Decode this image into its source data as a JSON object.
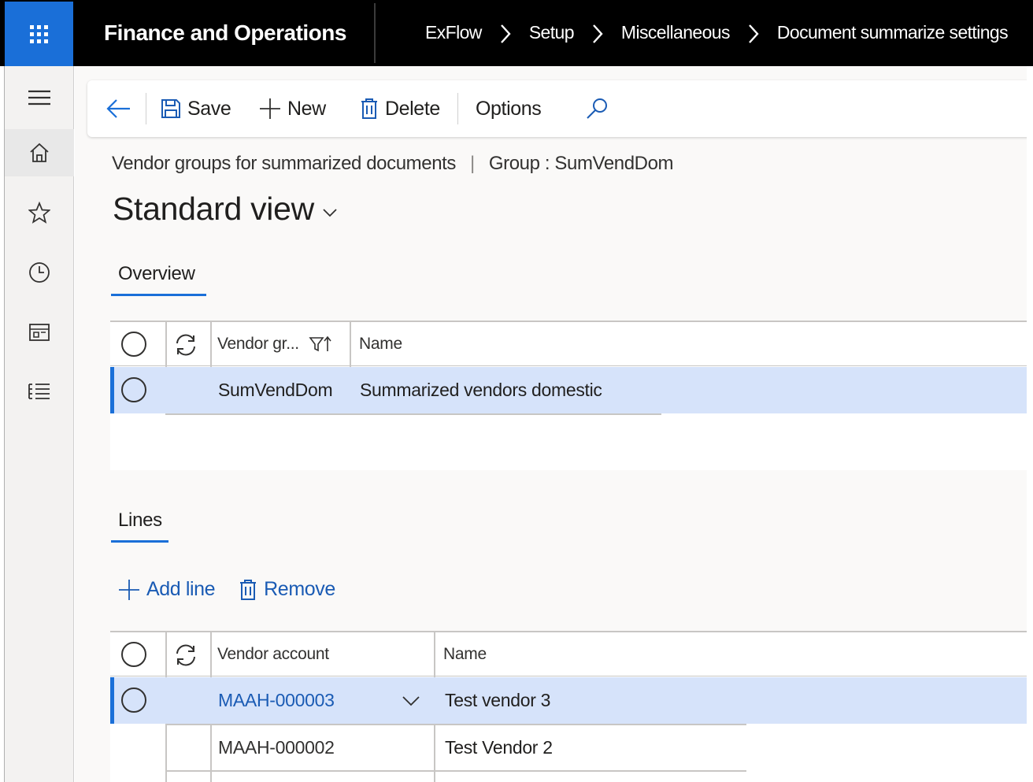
{
  "app": {
    "title": "Finance and Operations",
    "breadcrumb": [
      "ExFlow",
      "Setup",
      "Miscellaneous",
      "Document summarize settings"
    ]
  },
  "nav": {
    "items": [
      "home-icon",
      "favorites-star-icon",
      "recent-clock-icon",
      "workspaces-icon",
      "modules-list-icon"
    ]
  },
  "toolbar": {
    "save_label": "Save",
    "new_label": "New",
    "delete_label": "Delete",
    "options_label": "Options"
  },
  "page": {
    "caption": "Vendor groups for summarized documents",
    "caption_separator": "|",
    "record": "Group : SumVendDom",
    "view_title": "Standard view"
  },
  "overview": {
    "tab_label": "Overview",
    "columns": [
      "Vendor gr...",
      "Name"
    ],
    "rows": [
      {
        "vendor_group": "SumVendDom",
        "name": "Summarized vendors domestic",
        "selected": true
      }
    ]
  },
  "lines": {
    "tab_label": "Lines",
    "add_line_label": "Add line",
    "remove_label": "Remove",
    "columns": [
      "Vendor account",
      "Name"
    ],
    "rows": [
      {
        "vendor_account": "MAAH-000003",
        "name": "Test vendor 3",
        "selected": true
      },
      {
        "vendor_account": "MAAH-000002",
        "name": "Test Vendor 2",
        "selected": false
      }
    ]
  },
  "colors": {
    "accent": "#1a6fd8",
    "topbar": "#000000",
    "selected_row": "#d6e3fa",
    "link": "#1a5bb4"
  }
}
